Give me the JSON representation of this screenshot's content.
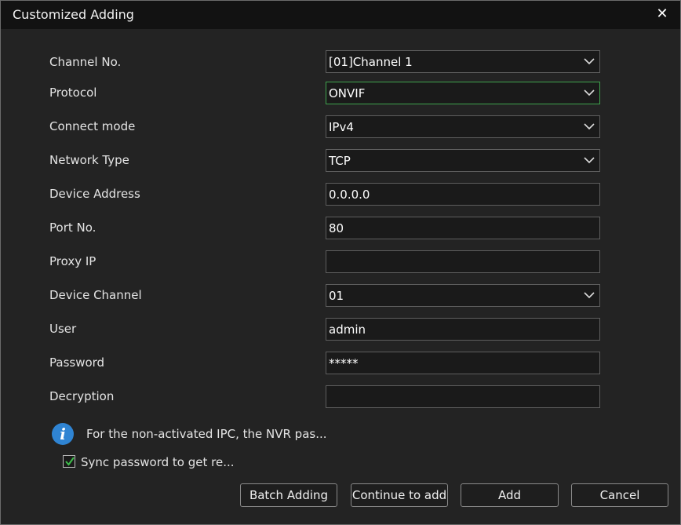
{
  "dialog": {
    "title": "Customized Adding",
    "close_icon": "close-icon"
  },
  "form": {
    "channel_no": {
      "label": "Channel No.",
      "value": "[01]Channel 1"
    },
    "protocol": {
      "label": "Protocol",
      "value": "ONVIF"
    },
    "connect_mode": {
      "label": "Connect mode",
      "value": "IPv4"
    },
    "network_type": {
      "label": "Network Type",
      "value": "TCP"
    },
    "device_address": {
      "label": "Device Address",
      "value": "0.0.0.0"
    },
    "port_no": {
      "label": "Port No.",
      "value": "80"
    },
    "proxy_ip": {
      "label": "Proxy IP",
      "value": ""
    },
    "device_channel": {
      "label": "Device Channel",
      "value": "01"
    },
    "user": {
      "label": "User",
      "value": "admin"
    },
    "password": {
      "label": "Password",
      "value": "*****"
    },
    "decryption": {
      "label": "Decryption",
      "value": ""
    }
  },
  "info": {
    "icon": "info-icon",
    "text": "For the non-activated IPC, the NVR pas..."
  },
  "sync": {
    "checked": true,
    "label": "Sync password to get re..."
  },
  "buttons": {
    "batch_adding": "Batch Adding",
    "continue_to_add": "Continue to add",
    "add": "Add",
    "cancel": "Cancel"
  },
  "colors": {
    "focus_border": "#3fa34d",
    "info_blue": "#2f84d3",
    "check_green": "#3fbf4c"
  }
}
